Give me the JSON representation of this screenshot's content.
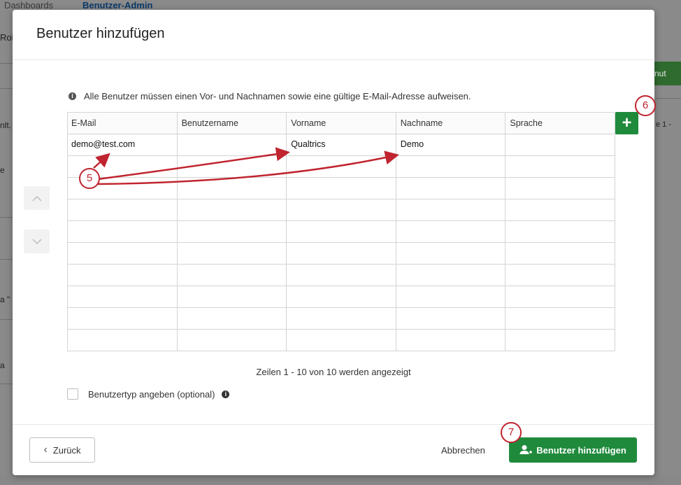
{
  "background": {
    "tabs": [
      "Dashboards",
      "Benutzer-Admin"
    ],
    "fragments": {
      "rol": "Rol",
      "nlt": "nlt.",
      "e": "e",
      "a_quote": "a \"",
      "a": "a",
      "right_top": "nut",
      "right_mid": "e 1 -"
    }
  },
  "modal": {
    "title": "Benutzer hinzufügen",
    "info_text": "Alle Benutzer müssen einen Vor- und Nachnamen sowie eine gültige E-Mail-Adresse aufweisen.",
    "table": {
      "columns": [
        "E-Mail",
        "Benutzername",
        "Vorname",
        "Nachname",
        "Sprache"
      ],
      "rows": [
        [
          "demo@test.com",
          "",
          "Qualtrics",
          "Demo",
          ""
        ],
        [
          "",
          "",
          "",
          "",
          ""
        ],
        [
          "",
          "",
          "",
          "",
          ""
        ],
        [
          "",
          "",
          "",
          "",
          ""
        ],
        [
          "",
          "",
          "",
          "",
          ""
        ],
        [
          "",
          "",
          "",
          "",
          ""
        ],
        [
          "",
          "",
          "",
          "",
          ""
        ],
        [
          "",
          "",
          "",
          "",
          ""
        ],
        [
          "",
          "",
          "",
          "",
          ""
        ],
        [
          "",
          "",
          "",
          "",
          ""
        ]
      ],
      "add_column_label": "+"
    },
    "rows_status": "Zeilen 1 - 10 von 10 werden angezeigt",
    "user_type_label": "Benutzertyp angeben (optional)",
    "back_label": "Zurück",
    "cancel_label": "Abbrechen",
    "submit_label": "Benutzer hinzufügen"
  },
  "annotations": [
    "5",
    "6",
    "7"
  ],
  "colors": {
    "accent_green": "#1f8a3c",
    "annotation_red": "#c0242f"
  },
  "icons": [
    "info-icon",
    "chevron-up-icon",
    "chevron-down-icon",
    "plus-icon",
    "chevron-left-icon",
    "add-user-icon"
  ]
}
